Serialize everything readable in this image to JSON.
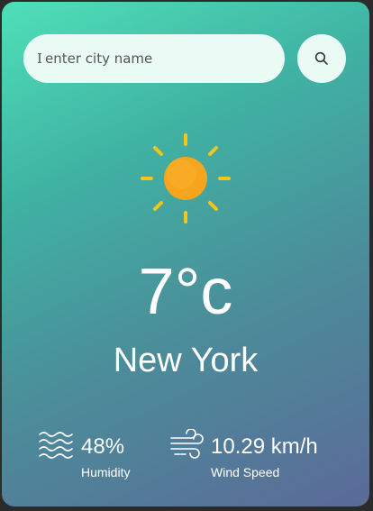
{
  "search": {
    "placeholder": "enter city name",
    "button_icon": "search-icon"
  },
  "weather": {
    "icon": "sun-icon",
    "temperature": "7°c",
    "city": "New York"
  },
  "details": {
    "humidity": {
      "icon": "humidity-waves-icon",
      "value": "48%",
      "label": "Humidity"
    },
    "wind": {
      "icon": "wind-icon",
      "value": "10.29 km/h",
      "label": "Wind Speed"
    }
  },
  "colors": {
    "gradient_start": "#4fe0b8",
    "gradient_end": "#5b6a98",
    "sun_core": "#f7a51c",
    "sun_rays": "#f5c518",
    "input_bg": "#eafaf4"
  }
}
